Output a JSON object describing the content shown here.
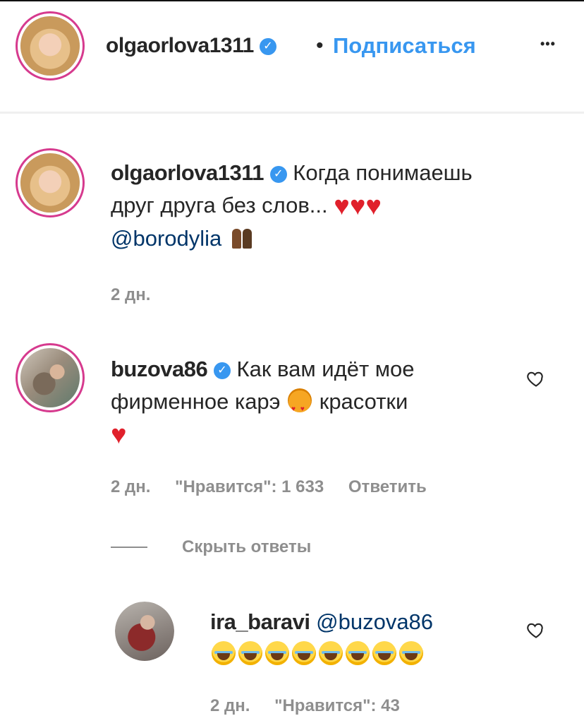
{
  "header": {
    "username": "olgaorlova1311",
    "separator": "•",
    "follow_label": "Подписаться",
    "more_label": "•••"
  },
  "caption": {
    "username": "olgaorlova1311",
    "text_line1": "Когда понимаешь",
    "text_line2": "друг друга без слов...",
    "mention": "@borodylia",
    "emoji": [
      "heart-emoji",
      "heart-emoji",
      "heart-emoji",
      "couple-emoji"
    ],
    "time": "2 дн."
  },
  "comments": [
    {
      "username": "buzova86",
      "text_line1": "Как вам идёт мое",
      "text_line2a": "фирменное карэ",
      "text_line2b": "красотки",
      "emoji": [
        "heart-eyes-cat-emoji",
        "heart-emoji"
      ],
      "time": "2 дн.",
      "likes": "\"Нравится\": 1 633",
      "reply_label": "Ответить",
      "hide_replies_label": "Скрыть ответы",
      "replies": [
        {
          "username": "ira_baravi",
          "mention": "@buzova86",
          "emoji": [
            "laughing-emoji",
            "laughing-emoji",
            "laughing-emoji",
            "laughing-emoji",
            "laughing-emoji",
            "laughing-emoji",
            "laughing-emoji",
            "laughing-emoji"
          ],
          "time": "2 дн.",
          "likes": "\"Нравится\": 43"
        }
      ]
    }
  ],
  "colors": {
    "link": "#3897f0",
    "mention": "#003569",
    "meta": "#8e8e8e",
    "avatar_ring": "#d63a8e",
    "heart": "#e0202b"
  }
}
